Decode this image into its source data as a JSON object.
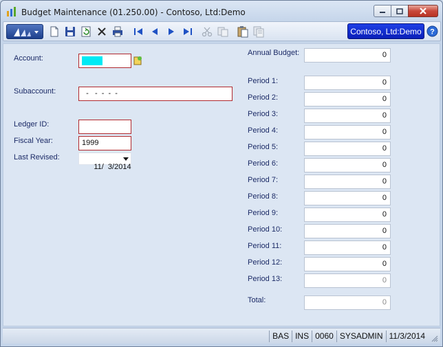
{
  "window": {
    "title": "Budget Maintenance (01.250.00) - Contoso, Ltd:Demo",
    "company": "Contoso, Ltd:Demo",
    "accent": "#0a1fb8",
    "required_border": "#b0282d"
  },
  "toolbar": {
    "icons": [
      "new-icon",
      "save-icon",
      "refresh-icon",
      "delete-icon",
      "print-icon",
      "first-icon",
      "previous-icon",
      "next-icon",
      "last-icon",
      "cut-icon",
      "copy-icon",
      "paste-icon",
      "attach-icon",
      "help-icon"
    ]
  },
  "form": {
    "account_label": "Account:",
    "account_value": "",
    "subaccount_label": "Subaccount:",
    "subaccount_value": "  -   -  -  -  -",
    "ledger_label": "Ledger ID:",
    "ledger_value": "",
    "fiscal_year_label": "Fiscal Year:",
    "fiscal_year_value": "1999",
    "last_revised_label": "Last Revised:",
    "last_revised_value": "11/  3/2014",
    "annual_budget_label": "Annual Budget:",
    "annual_budget_value": "0",
    "periods": [
      {
        "label": "Period 1:",
        "value": "0"
      },
      {
        "label": "Period 2:",
        "value": "0"
      },
      {
        "label": "Period 3:",
        "value": "0"
      },
      {
        "label": "Period 4:",
        "value": "0"
      },
      {
        "label": "Period 5:",
        "value": "0"
      },
      {
        "label": "Period 6:",
        "value": "0"
      },
      {
        "label": "Period 7:",
        "value": "0"
      },
      {
        "label": "Period 8:",
        "value": "0"
      },
      {
        "label": "Period 9:",
        "value": "0"
      },
      {
        "label": "Period 10:",
        "value": "0"
      },
      {
        "label": "Period 11:",
        "value": "0"
      },
      {
        "label": "Period 12:",
        "value": "0"
      },
      {
        "label": "Period 13:",
        "value": "0"
      }
    ],
    "total_label": "Total:",
    "total_value": "0"
  },
  "status": {
    "mode": "BAS",
    "insert": "INS",
    "code": "0060",
    "user": "SYSADMIN",
    "date": "11/3/2014"
  }
}
